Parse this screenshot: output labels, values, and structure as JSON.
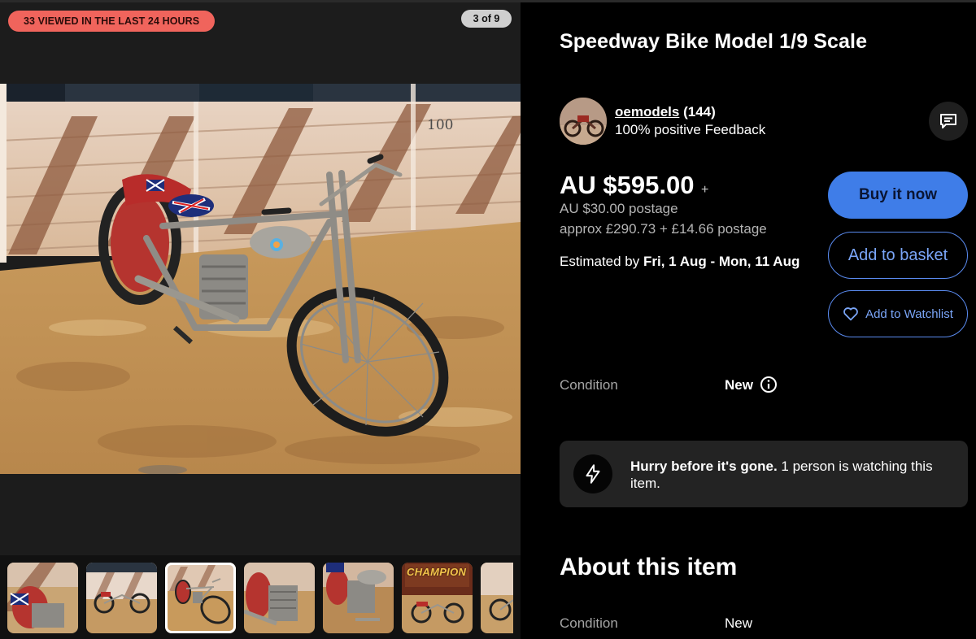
{
  "gallery": {
    "views_badge": "33 VIEWED IN THE LAST 24 HOURS",
    "counter": "3 of 9",
    "photo_sign_text": "100",
    "thumbnails": [
      {
        "label": ""
      },
      {
        "label": ""
      },
      {
        "label": "",
        "selected": true
      },
      {
        "label": ""
      },
      {
        "label": ""
      },
      {
        "label": "CHAMPION"
      },
      {
        "label": ""
      }
    ]
  },
  "listing": {
    "title": "Speedway Bike Model 1/9 Scale"
  },
  "seller": {
    "name": "oemodels",
    "feedback_count": "(144)",
    "feedback_text": "100% positive Feedback",
    "contact_icon": "message-icon"
  },
  "pricing": {
    "price": "AU $595.00",
    "plus": "+",
    "postage": "AU $30.00 postage",
    "approx": "approx £290.73 + £14.66 postage",
    "estimate_prefix": "Estimated by ",
    "estimate_dates": "Fri, 1 Aug - Mon, 11 Aug"
  },
  "actions": {
    "buy_now": "Buy it now",
    "add_to_basket": "Add to basket",
    "add_to_watchlist": "Add to Watchlist",
    "watch_icon": "heart-icon"
  },
  "condition": {
    "label": "Condition",
    "value": "New",
    "info_icon": "info-icon"
  },
  "hurry": {
    "icon": "lightning-icon",
    "bold": "Hurry before it's gone.",
    "rest": " 1 person is watching this item."
  },
  "about": {
    "heading": "About this item",
    "condition_label": "Condition",
    "condition_value": "New"
  },
  "colors": {
    "accent_blue": "#3f7de8",
    "badge_red": "#f0645c",
    "background": "#000000"
  }
}
